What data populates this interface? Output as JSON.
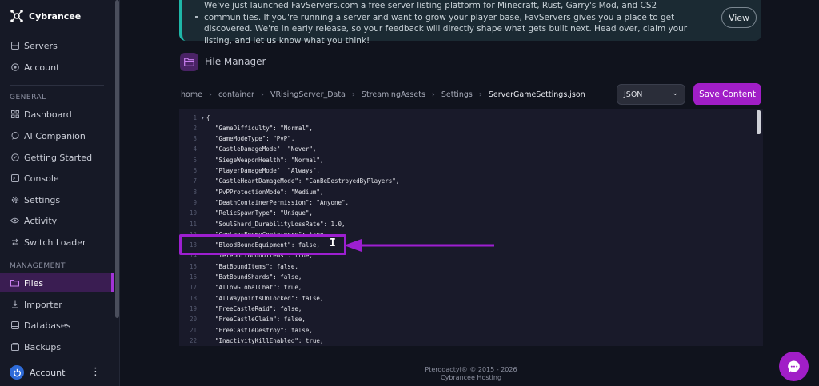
{
  "brand": {
    "name": "Cybrancee"
  },
  "sidebar": {
    "top_items": [
      {
        "label": "Servers",
        "icon": "server-icon"
      },
      {
        "label": "Account",
        "icon": "account-icon"
      }
    ],
    "general_heading": "GENERAL",
    "general_items": [
      {
        "label": "Dashboard",
        "icon": "grid-icon"
      },
      {
        "label": "AI Companion",
        "icon": "chat-icon"
      },
      {
        "label": "Getting Started",
        "icon": "rocket-icon"
      },
      {
        "label": "Console",
        "icon": "terminal-icon"
      },
      {
        "label": "Settings",
        "icon": "gear-icon"
      },
      {
        "label": "Activity",
        "icon": "eye-icon"
      },
      {
        "label": "Switch Loader",
        "icon": "switch-icon"
      }
    ],
    "management_heading": "MANAGEMENT",
    "management_items": [
      {
        "label": "Files",
        "icon": "folder-icon",
        "active": true
      },
      {
        "label": "Importer",
        "icon": "download-icon"
      },
      {
        "label": "Databases",
        "icon": "database-icon"
      },
      {
        "label": "Backups",
        "icon": "backup-icon"
      }
    ],
    "footer_label": "Account"
  },
  "announcement": {
    "text": "We've just launched FavServers.com a free server listing platform for Minecraft, Rust, Garry's Mod, and CS2 communities. If you're running a server and want to grow your player base, FavServers gives you a place to get discovered. We're in early release, so your feedback will directly shape what gets built next. Head over, claim your listing, and let us know what you think!",
    "button_label": "View"
  },
  "file_manager": {
    "title": "File Manager",
    "breadcrumb": [
      "home",
      "container",
      "VRisingServer_Data",
      "StreamingAssets",
      "Settings",
      "ServerGameSettings.json"
    ],
    "format_selected": "JSON",
    "save_label": "Save Content"
  },
  "editor": {
    "lines": [
      {
        "n": "1",
        "text": "{"
      },
      {
        "n": "2",
        "text": "\"GameDifficulty\": \"Normal\","
      },
      {
        "n": "3",
        "text": "\"GameModeType\": \"PvP\","
      },
      {
        "n": "4",
        "text": "\"CastleDamageMode\": \"Never\","
      },
      {
        "n": "5",
        "text": "\"SiegeWeaponHealth\": \"Normal\","
      },
      {
        "n": "6",
        "text": "\"PlayerDamageMode\": \"Always\","
      },
      {
        "n": "7",
        "text": "\"CastleHeartDamageMode\": \"CanBeDestroyedByPlayers\","
      },
      {
        "n": "8",
        "text": "\"PvPProtectionMode\": \"Medium\","
      },
      {
        "n": "9",
        "text": "\"DeathContainerPermission\": \"Anyone\","
      },
      {
        "n": "10",
        "text": "\"RelicSpawnType\": \"Unique\","
      },
      {
        "n": "11",
        "text": "\"SoulShard_DurabilityLossRate\": 1.0,"
      },
      {
        "n": "12",
        "text": "\"CanLootEnemyContainers\": true,"
      },
      {
        "n": "13",
        "text": "\"BloodBoundEquipment\": false,"
      },
      {
        "n": "14",
        "text": "\"TeleportBoundItems\": true,"
      },
      {
        "n": "15",
        "text": "\"BatBoundItems\": false,"
      },
      {
        "n": "16",
        "text": "\"BatBoundShards\": false,"
      },
      {
        "n": "17",
        "text": "\"AllowGlobalChat\": true,"
      },
      {
        "n": "18",
        "text": "\"AllWaypointsUnlocked\": false,"
      },
      {
        "n": "19",
        "text": "\"FreeCastleRaid\": false,"
      },
      {
        "n": "20",
        "text": "\"FreeCastleClaim\": false,"
      },
      {
        "n": "21",
        "text": "\"FreeCastleDestroy\": false,"
      },
      {
        "n": "22",
        "text": "\"InactivityKillEnabled\": true,"
      }
    ]
  },
  "footer": {
    "line1": "Pterodactyl® © 2015 - 2026",
    "line2": "Cybrancee Hosting"
  },
  "colors": {
    "accent": "#a11ec7",
    "announcement_border": "#1fb6a8",
    "highlight": "#9d1fd0"
  }
}
